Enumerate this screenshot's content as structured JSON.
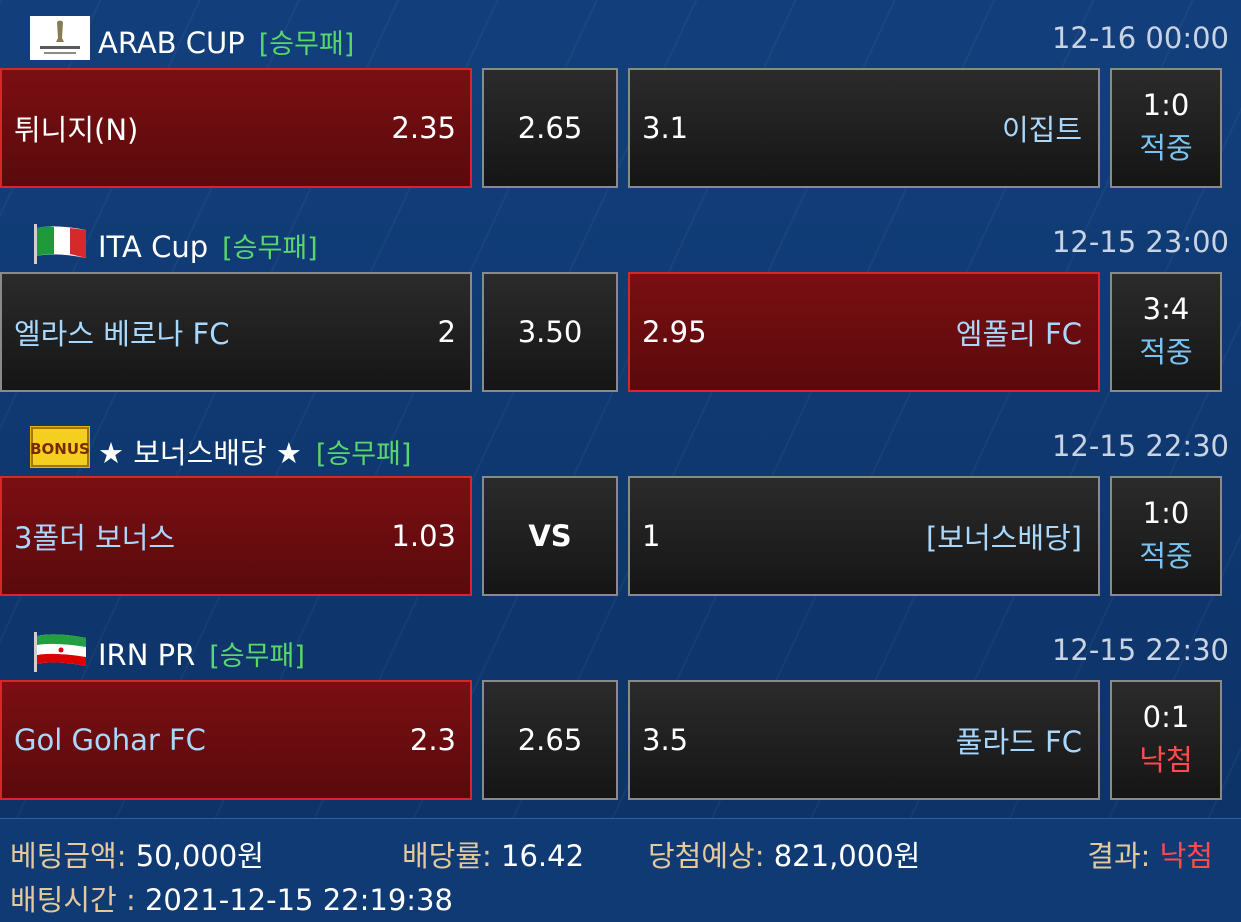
{
  "matches": [
    {
      "league": "ARAB CUP",
      "type": "[승무패]",
      "time": "12-16 00:00",
      "icon": "arab-cup-logo",
      "home": {
        "name": "튀니지(N)",
        "odds": "2.35",
        "selected": true
      },
      "draw": {
        "odds": "2.65",
        "selected": false
      },
      "away": {
        "odds": "3.1",
        "name": "이집트",
        "selected": false
      },
      "result": {
        "score": "1:0",
        "label": "적중"
      }
    },
    {
      "league": "ITA Cup",
      "type": "[승무패]",
      "time": "12-15 23:00",
      "icon": "italy-flag",
      "home": {
        "name": "엘라스 베로나 FC",
        "odds": "2",
        "selected": false
      },
      "draw": {
        "odds": "3.50",
        "selected": false
      },
      "away": {
        "odds": "2.95",
        "name": "엠폴리 FC",
        "selected": true
      },
      "result": {
        "score": "3:4",
        "label": "적중"
      }
    },
    {
      "league": "★ 보너스배당 ★",
      "type": "[승무패]",
      "time": "12-15 22:30",
      "icon": "bonus-badge",
      "icon_text": "BONUS",
      "home": {
        "name": "3폴더 보너스",
        "odds": "1.03",
        "selected": true
      },
      "draw": {
        "odds": "VS",
        "selected": false
      },
      "away": {
        "odds": "1",
        "name": "[보너스배당]",
        "selected": false
      },
      "result": {
        "score": "1:0",
        "label": "적중"
      }
    },
    {
      "league": "IRN PR",
      "type": "[승무패]",
      "time": "12-15 22:30",
      "icon": "iran-flag",
      "home": {
        "name": "Gol Gohar FC",
        "odds": "2.3",
        "selected": true
      },
      "draw": {
        "odds": "2.65",
        "selected": false
      },
      "away": {
        "odds": "3.5",
        "name": "풀라드 FC",
        "selected": false
      },
      "result": {
        "score": "0:1",
        "label": "낙첨"
      }
    }
  ],
  "footer": {
    "bet_amount_label": "베팅금액:",
    "bet_amount": "50,000원",
    "odds_label": "배당률:",
    "odds": "16.42",
    "expected_label": "당첨예상:",
    "expected": "821,000원",
    "result_label": "결과:",
    "result": "낙첨",
    "time_label": "배팅시간 :",
    "time": "2021-12-15 22:19:38"
  },
  "colors": {
    "background": "#0f3a74",
    "selected": "#7a0f12",
    "hit": "#79c3f2",
    "miss": "#ff4b4b",
    "type": "#58d76a"
  }
}
